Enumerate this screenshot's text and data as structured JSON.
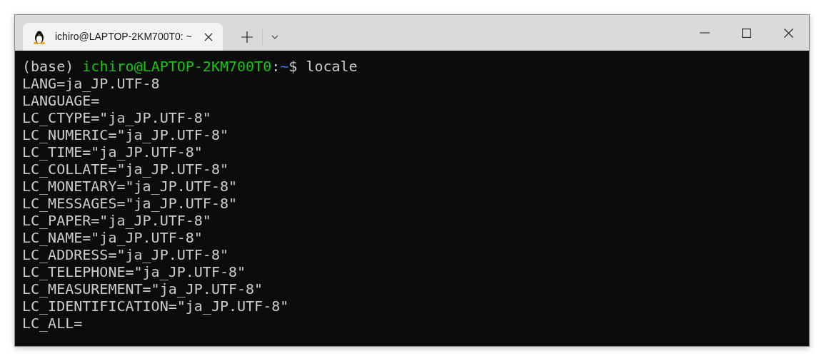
{
  "tab": {
    "title": "ichiro@LAPTOP-2KM700T0: ~",
    "selected": true
  },
  "terminal": {
    "lines": [
      {
        "kind": "prompt",
        "segments": [
          {
            "text": "(base) ",
            "kind": "plain"
          },
          {
            "text": "ichiro@LAPTOP-2KM700T0",
            "kind": "user"
          },
          {
            "text": ":",
            "kind": "plain"
          },
          {
            "text": "~",
            "kind": "path"
          },
          {
            "text": "$ locale",
            "kind": "plain"
          }
        ]
      },
      {
        "kind": "output",
        "text": "LANG=ja_JP.UTF-8"
      },
      {
        "kind": "output",
        "text": "LANGUAGE="
      },
      {
        "kind": "output",
        "text": "LC_CTYPE=\"ja_JP.UTF-8\""
      },
      {
        "kind": "output",
        "text": "LC_NUMERIC=\"ja_JP.UTF-8\""
      },
      {
        "kind": "output",
        "text": "LC_TIME=\"ja_JP.UTF-8\""
      },
      {
        "kind": "output",
        "text": "LC_COLLATE=\"ja_JP.UTF-8\""
      },
      {
        "kind": "output",
        "text": "LC_MONETARY=\"ja_JP.UTF-8\""
      },
      {
        "kind": "output",
        "text": "LC_MESSAGES=\"ja_JP.UTF-8\""
      },
      {
        "kind": "output",
        "text": "LC_PAPER=\"ja_JP.UTF-8\""
      },
      {
        "kind": "output",
        "text": "LC_NAME=\"ja_JP.UTF-8\""
      },
      {
        "kind": "output",
        "text": "LC_ADDRESS=\"ja_JP.UTF-8\""
      },
      {
        "kind": "output",
        "text": "LC_TELEPHONE=\"ja_JP.UTF-8\""
      },
      {
        "kind": "output",
        "text": "LC_MEASUREMENT=\"ja_JP.UTF-8\""
      },
      {
        "kind": "output",
        "text": "LC_IDENTIFICATION=\"ja_JP.UTF-8\""
      },
      {
        "kind": "output",
        "text": "LC_ALL="
      }
    ]
  }
}
